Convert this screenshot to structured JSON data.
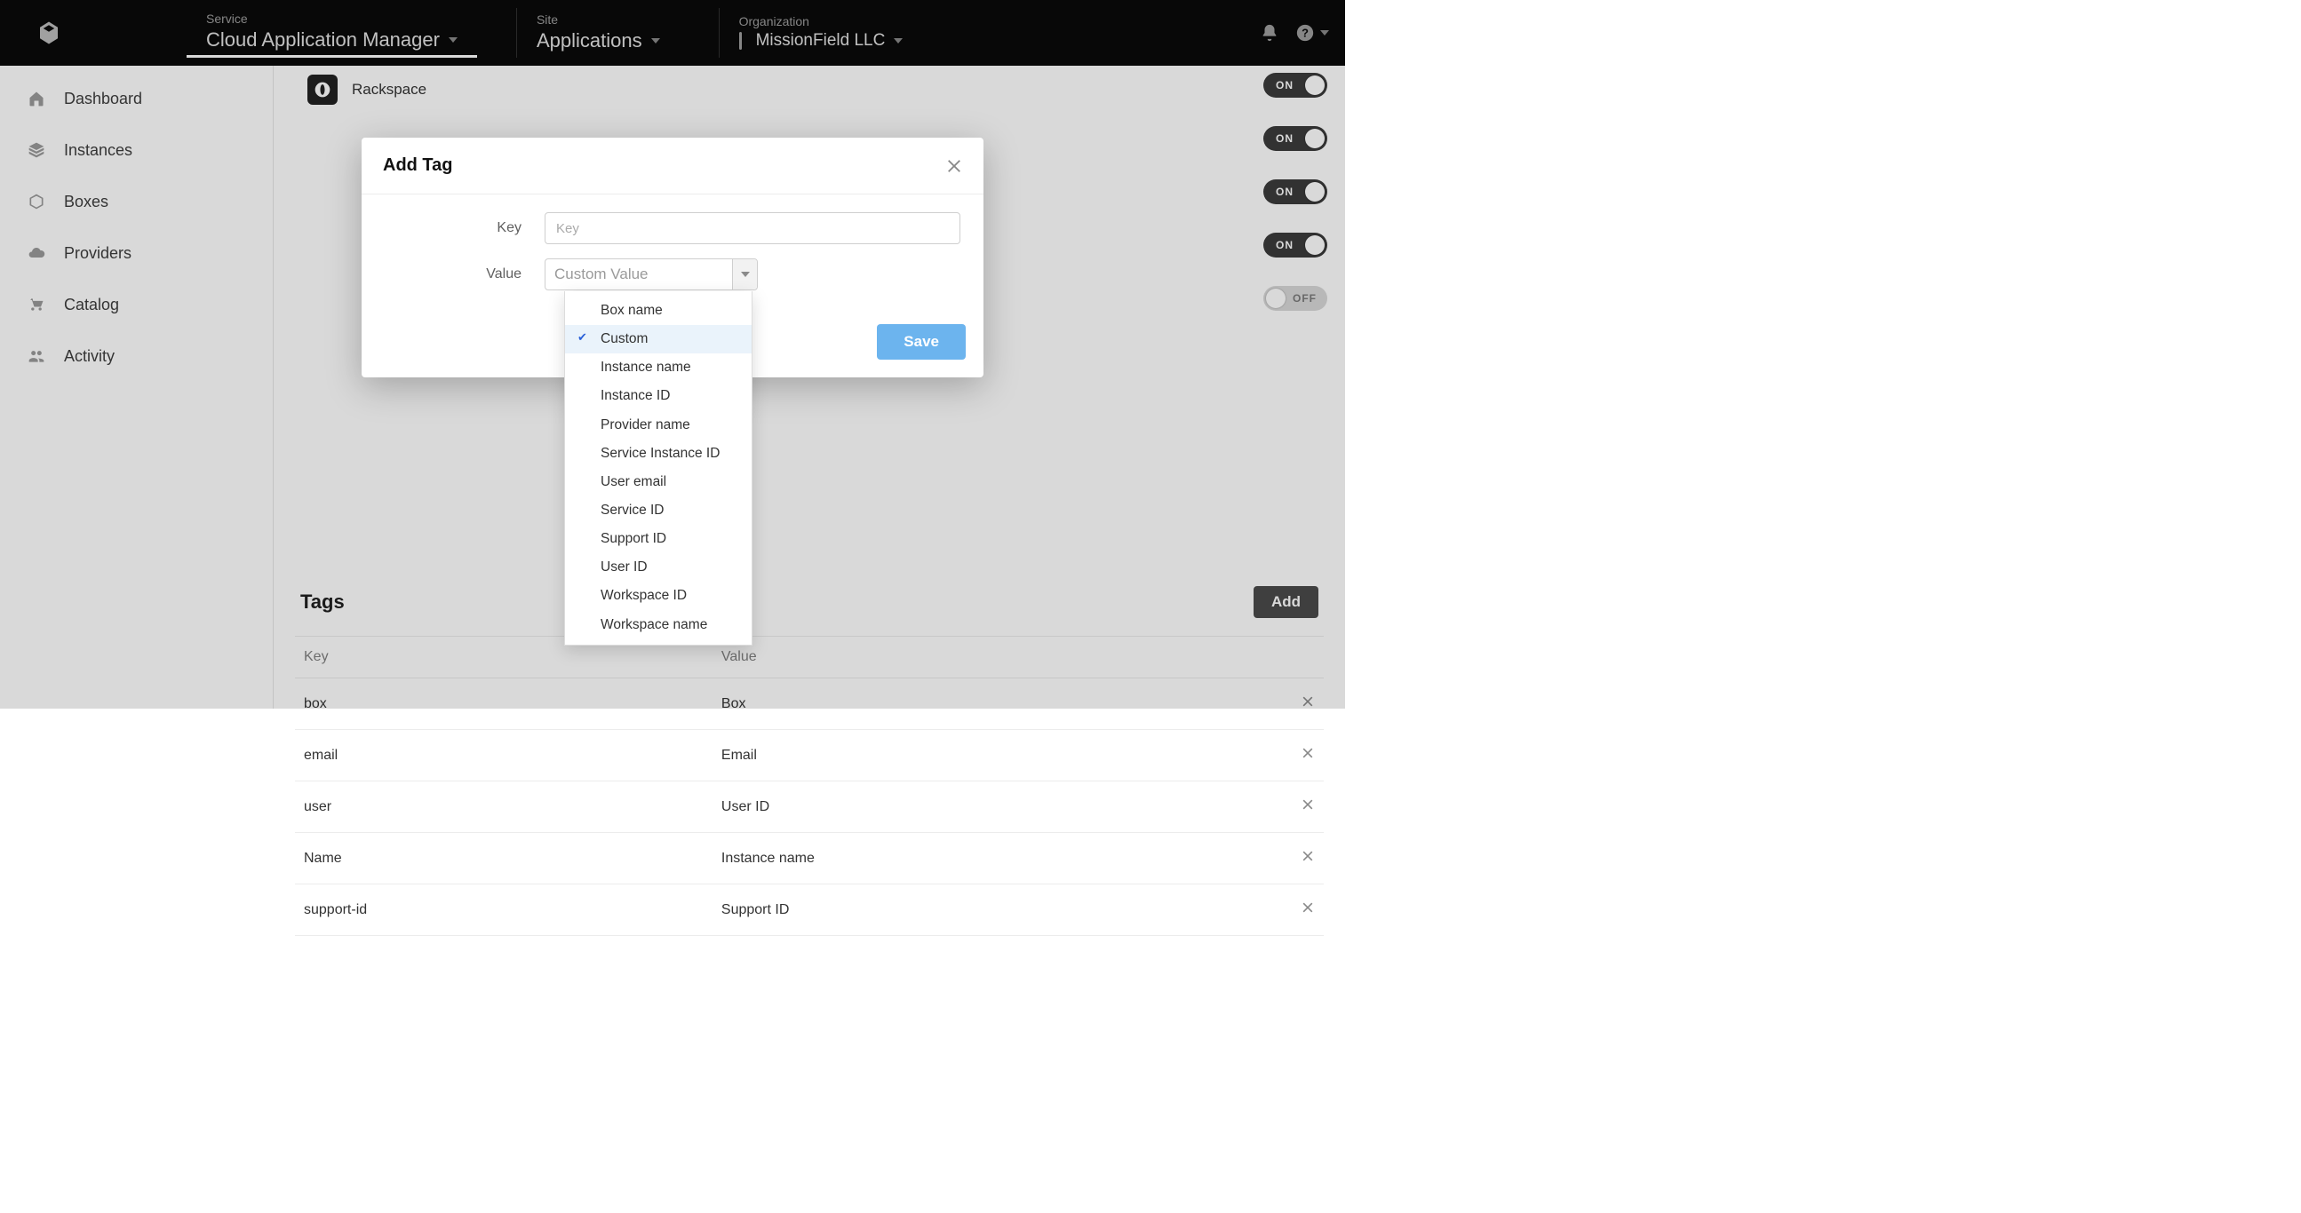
{
  "header": {
    "service_label": "Service",
    "service_value": "Cloud Application Manager",
    "site_label": "Site",
    "site_value": "Applications",
    "org_label": "Organization",
    "org_value": "MissionField LLC"
  },
  "sidebar": {
    "items": [
      {
        "label": "Dashboard"
      },
      {
        "label": "Instances"
      },
      {
        "label": "Boxes"
      },
      {
        "label": "Providers"
      },
      {
        "label": "Catalog"
      },
      {
        "label": "Activity"
      }
    ]
  },
  "providers": [
    {
      "name": "Rackspace",
      "status": "ON"
    }
  ],
  "toggles": [
    {
      "status": "ON"
    },
    {
      "status": "ON"
    },
    {
      "status": "ON"
    },
    {
      "status": "ON"
    },
    {
      "status": "OFF"
    }
  ],
  "tags_section": {
    "title": "Tags",
    "add_label": "Add",
    "columns": {
      "key": "Key",
      "value": "Value"
    },
    "rows": [
      {
        "key": "box",
        "value": "Box"
      },
      {
        "key": "email",
        "value": "Email"
      },
      {
        "key": "user",
        "value": "User ID"
      },
      {
        "key": "Name",
        "value": "Instance name"
      },
      {
        "key": "support-id",
        "value": "Support ID"
      }
    ]
  },
  "modal": {
    "title": "Add Tag",
    "key_label": "Key",
    "key_placeholder": "Key",
    "key_value": "",
    "value_label": "Value",
    "value_display": "Custom Value",
    "save_label": "Save",
    "options": [
      {
        "label": "Box name",
        "selected": false
      },
      {
        "label": "Custom",
        "selected": true
      },
      {
        "label": "Instance name",
        "selected": false
      },
      {
        "label": "Instance ID",
        "selected": false
      },
      {
        "label": "Provider name",
        "selected": false
      },
      {
        "label": "Service Instance ID",
        "selected": false
      },
      {
        "label": "User email",
        "selected": false
      },
      {
        "label": "Service ID",
        "selected": false
      },
      {
        "label": "Support ID",
        "selected": false
      },
      {
        "label": "User ID",
        "selected": false
      },
      {
        "label": "Workspace ID",
        "selected": false
      },
      {
        "label": "Workspace name",
        "selected": false
      }
    ]
  }
}
